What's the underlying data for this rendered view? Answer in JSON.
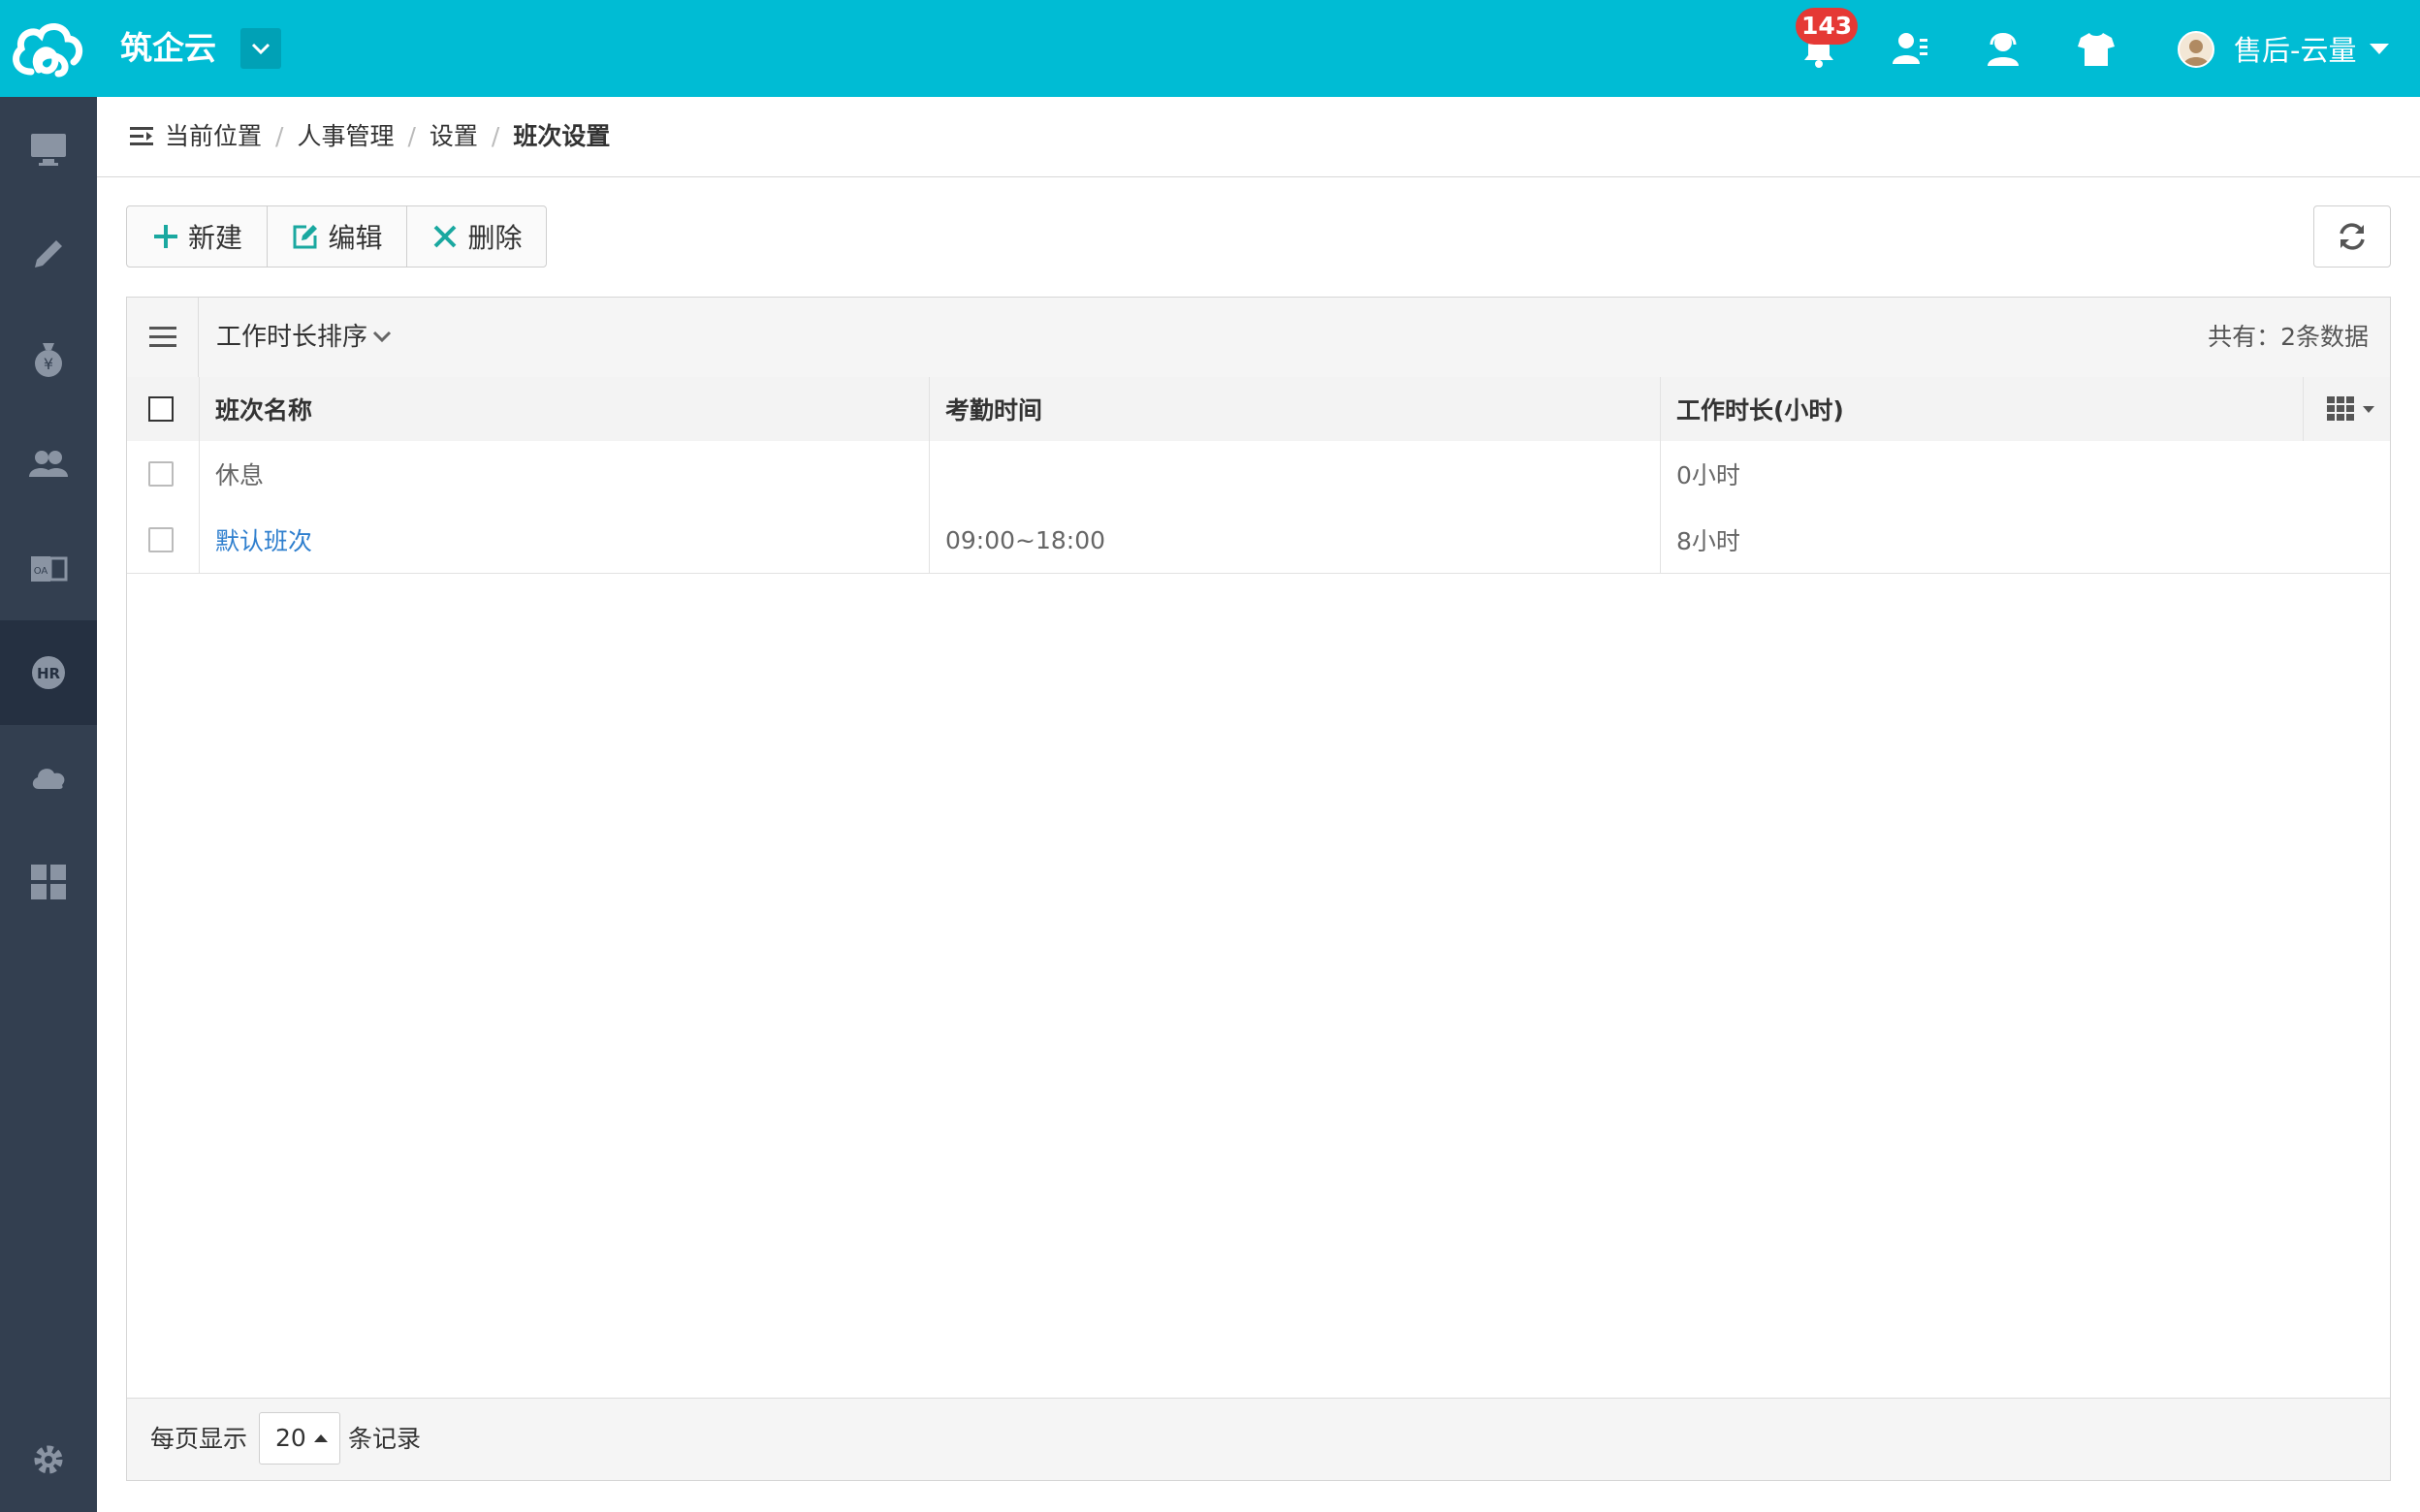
{
  "app": {
    "name": "筑企云"
  },
  "header": {
    "notification_count": "143",
    "username": "售后-云量",
    "icons": [
      "bell-icon",
      "user-contact-icon",
      "support-icon",
      "shirt-icon"
    ]
  },
  "sidebar": {
    "items": [
      {
        "icon": "monitor-icon"
      },
      {
        "icon": "pencil-icon"
      },
      {
        "icon": "moneybag-icon"
      },
      {
        "icon": "users-icon"
      },
      {
        "icon": "office-icon"
      },
      {
        "icon": "hr-icon",
        "active": true
      },
      {
        "icon": "cloud-icon"
      },
      {
        "icon": "grid-icon"
      },
      {
        "icon": "settings-icon"
      }
    ]
  },
  "breadcrumb": {
    "items": [
      "当前位置",
      "人事管理",
      "设置",
      "班次设置"
    ]
  },
  "toolbar": {
    "new_label": "新建",
    "edit_label": "编辑",
    "delete_label": "删除"
  },
  "table": {
    "sort_label": "工作时长排序",
    "total_text": "共有：2条数据",
    "columns": [
      "班次名称",
      "考勤时间",
      "工作时长(小时)"
    ],
    "rows": [
      {
        "name": "休息",
        "time": "",
        "hours": "0小时"
      },
      {
        "name": "默认班次",
        "time": "09:00~18:00",
        "hours": "8小时"
      }
    ]
  },
  "footer": {
    "per_page_prefix": "每页显示",
    "page_size": "20",
    "per_page_suffix": "条记录"
  },
  "colors": {
    "header_bg": "#00bcd4",
    "sidebar_bg": "#333f50",
    "accent": "#1aa8a0",
    "link": "#2f7fce",
    "badge": "#e53935"
  }
}
